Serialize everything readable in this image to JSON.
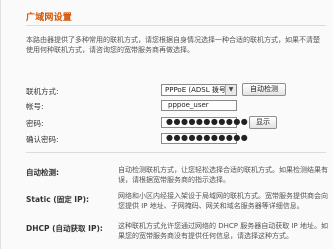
{
  "page": {
    "title": "广域网设置",
    "intro": "本路由器提供了多种常用的联机方式，请您根据自身情况选择一种合适的联机方式，如果不清楚使用何种联机方式，请咨询您的宽带服务商再做选择。"
  },
  "form": {
    "connection_type_label": "联机方式:",
    "connection_type_value": "PPPoE (ADSL 拨号)",
    "auto_detect_label": "自动检测",
    "account_label": "帐号:",
    "account_value": "pppoe_user",
    "password_label": "密码:",
    "password_value": "●●●●●●●●●●●",
    "confirm_password_label": "确认密码:",
    "confirm_password_value": "●●●●●●●●●●●",
    "show_label": "显示"
  },
  "help": [
    {
      "label": "自动检测:",
      "text": "自动检测联机方式，让您轻松选择合适的联机方式。如果检测结果有误，请根据宽带服务商的指示选择。"
    },
    {
      "label": "Static (固定 IP):",
      "text": "网络和小区内经接入架设于局域网的联机方式。宽带服务提供商会向您提供 IP 地址、子网掩码、网关和域名服务器等详细信息。"
    },
    {
      "label": "DHCP (自动获取 IP):",
      "text": "这种联机方式允许您通过网络的 DHCP 服务器自动获取 IP 地址。如果您的宽带服务商没有提供任何信息，请选择这种方式。"
    }
  ]
}
